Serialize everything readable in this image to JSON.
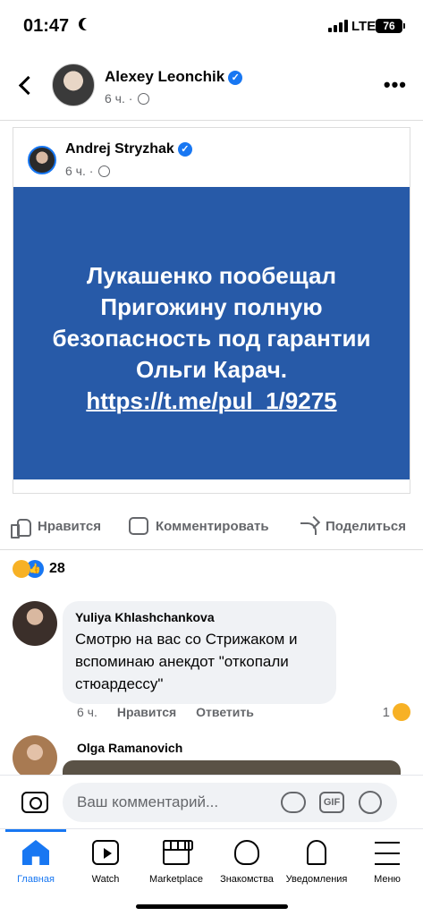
{
  "status_bar": {
    "time": "01:47",
    "network": "LTE",
    "battery": "76"
  },
  "post": {
    "author": "Alexey Leonchik",
    "time": "6 ч. ·",
    "shared": {
      "author": "Andrej Stryzhak",
      "time": "6 ч. ·",
      "image_text": "Лукашенко пообещал Пригожину полную безопасность под гарантии Ольги Карач.",
      "image_link": "https://t.me/pul_1/9275"
    },
    "actions": {
      "like": "Нравится",
      "comment": "Комментировать",
      "share": "Поделиться"
    },
    "reaction_count": "28"
  },
  "comments": [
    {
      "author": "Yuliya Khlashchankova",
      "text": "Смотрю на вас со Стрижаком и вспоминаю анекдот \"откопали стюардессу\"",
      "time": "6 ч.",
      "like": "Нравится",
      "reply": "Ответить",
      "reactions": "1"
    },
    {
      "author": "Olga Ramanovich"
    }
  ],
  "comment_input": {
    "placeholder": "Ваш комментарий..."
  },
  "colors": {
    "accent": "#1877f2",
    "post_image_bg": "#275aa8"
  },
  "tabs": [
    {
      "label": "Главная",
      "icon": "home-icon",
      "active": true
    },
    {
      "label": "Watch",
      "icon": "watch-icon"
    },
    {
      "label": "Marketplace",
      "icon": "marketplace-icon"
    },
    {
      "label": "Знакомства",
      "icon": "dating-icon"
    },
    {
      "label": "Уведомления",
      "icon": "bell-icon"
    },
    {
      "label": "Меню",
      "icon": "menu-icon"
    }
  ]
}
